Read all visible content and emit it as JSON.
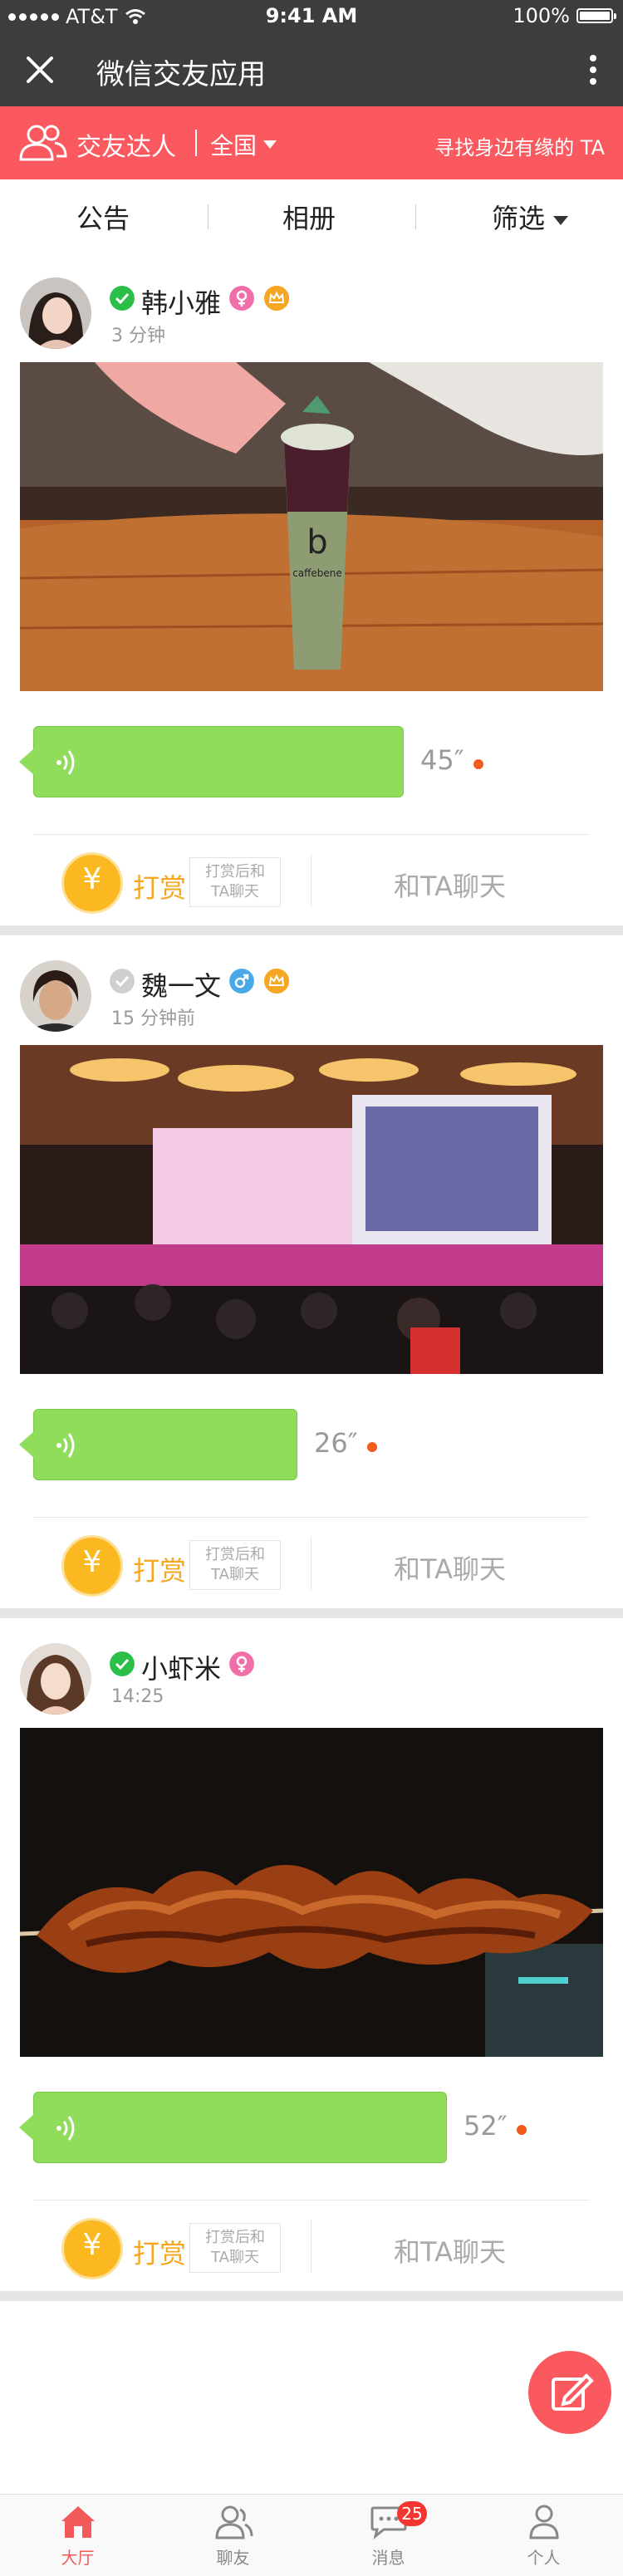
{
  "status_bar": {
    "carrier": "AT&T",
    "time": "9:41 AM",
    "battery": "100%",
    "battery_level": 1.0
  },
  "titlebar": {
    "title": "微信交友应用",
    "close_icon": "close-icon",
    "more_icon": "more-vertical-icon"
  },
  "redbar": {
    "label": "交友达人",
    "region": "全国",
    "find_text": "寻找身边有缘的 TA",
    "bg_color": "#fa5a5f"
  },
  "tabs": {
    "notice": "公告",
    "album": "相册",
    "filter": "筛选"
  },
  "posts": [
    {
      "name": "韩小雅",
      "verified": true,
      "gender": "female",
      "vip": true,
      "time": "3 分钟",
      "voice_duration": "45″",
      "tip_label": "打赏",
      "tip_note_1": "打赏后和",
      "tip_note_2": "TA聊天",
      "chat_label": "和TA聊天"
    },
    {
      "name": "魏一文",
      "verified": false,
      "gender": "male",
      "vip": true,
      "time": "15 分钟前",
      "voice_duration": "26″",
      "tip_label": "打赏",
      "tip_note_1": "打赏后和",
      "tip_note_2": "TA聊天",
      "chat_label": "和TA聊天"
    },
    {
      "name": "小虾米",
      "verified": true,
      "gender": "female",
      "vip": false,
      "time": "14:25",
      "voice_duration": "52″",
      "tip_label": "打赏",
      "tip_note_1": "打赏后和",
      "tip_note_2": "TA聊天",
      "chat_label": "和TA聊天"
    }
  ],
  "bottom_nav": {
    "items": [
      {
        "label": "大厅",
        "icon": "home-icon",
        "active": true
      },
      {
        "label": "聊友",
        "icon": "friends-icon",
        "active": false
      },
      {
        "label": "消息",
        "icon": "message-icon",
        "active": false,
        "badge": "25"
      },
      {
        "label": "个人",
        "icon": "profile-icon",
        "active": false
      }
    ]
  },
  "colors": {
    "accent": "#fa5a5f",
    "voice_bubble": "#8fdd5a",
    "tip": "#f5a623",
    "verified": "#2bbf4a",
    "female": "#f06fa9",
    "male": "#4aa8e8"
  }
}
